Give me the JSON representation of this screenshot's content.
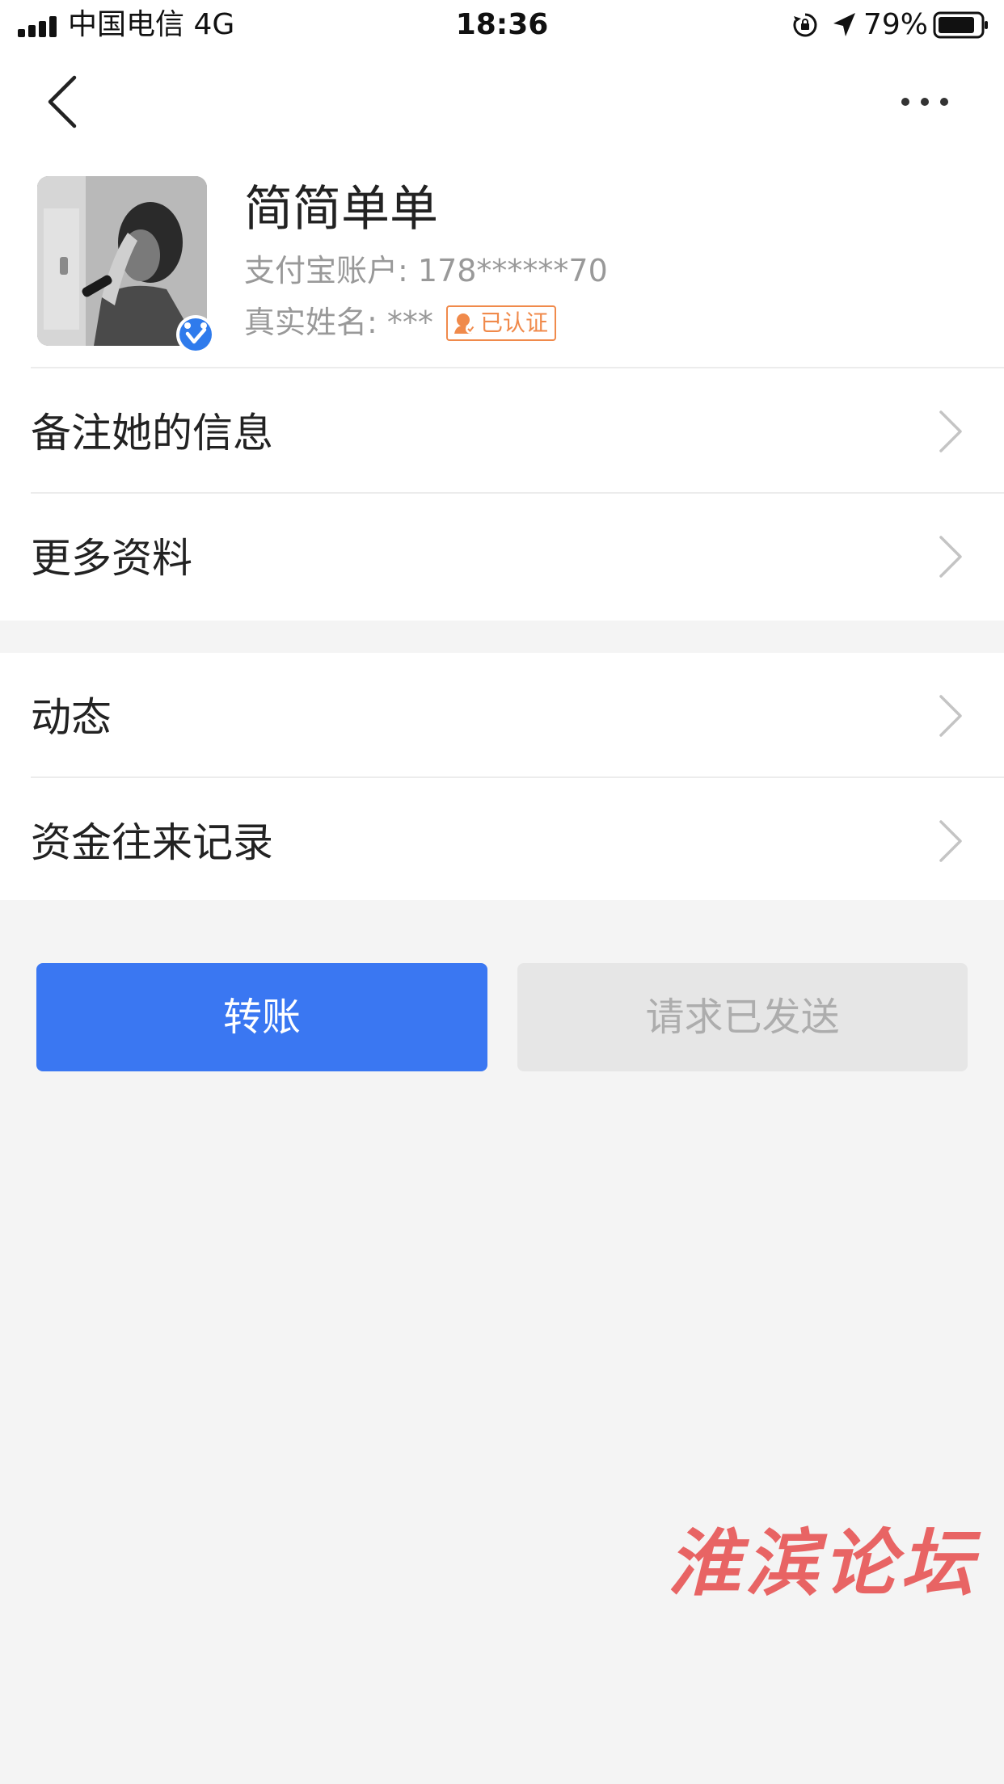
{
  "status_bar": {
    "carrier": "中国电信  4G",
    "time": "18:36",
    "battery_percent": "79%",
    "icons": [
      "signal-icon",
      "rotation-lock-icon",
      "location-arrow-icon",
      "battery-icon"
    ]
  },
  "nav": {
    "back_icon": "chevron-left-icon",
    "more_icon": "more-dots-icon"
  },
  "profile": {
    "name": "简简单单",
    "account_label": "支付宝账户:",
    "account_value": "178******70",
    "realname_label": "真实姓名:",
    "realname_value": "***",
    "verified_tag": "已认证",
    "verified_badge_icon": "verified-badge-icon"
  },
  "menu_group_1": [
    {
      "label": "备注她的信息"
    },
    {
      "label": "更多资料"
    }
  ],
  "menu_group_2": [
    {
      "label": "动态"
    },
    {
      "label": "资金往来记录"
    }
  ],
  "actions": {
    "transfer_label": "转账",
    "request_label": "请求已发送"
  },
  "watermark": "淮滨论坛",
  "colors": {
    "primary": "#3a77f2",
    "disabled_bg": "#e6e6e6",
    "disabled_text": "#adadad",
    "tag_orange": "#f08a4b",
    "page_bg": "#f4f4f4",
    "watermark_red": "#e64c4c"
  }
}
